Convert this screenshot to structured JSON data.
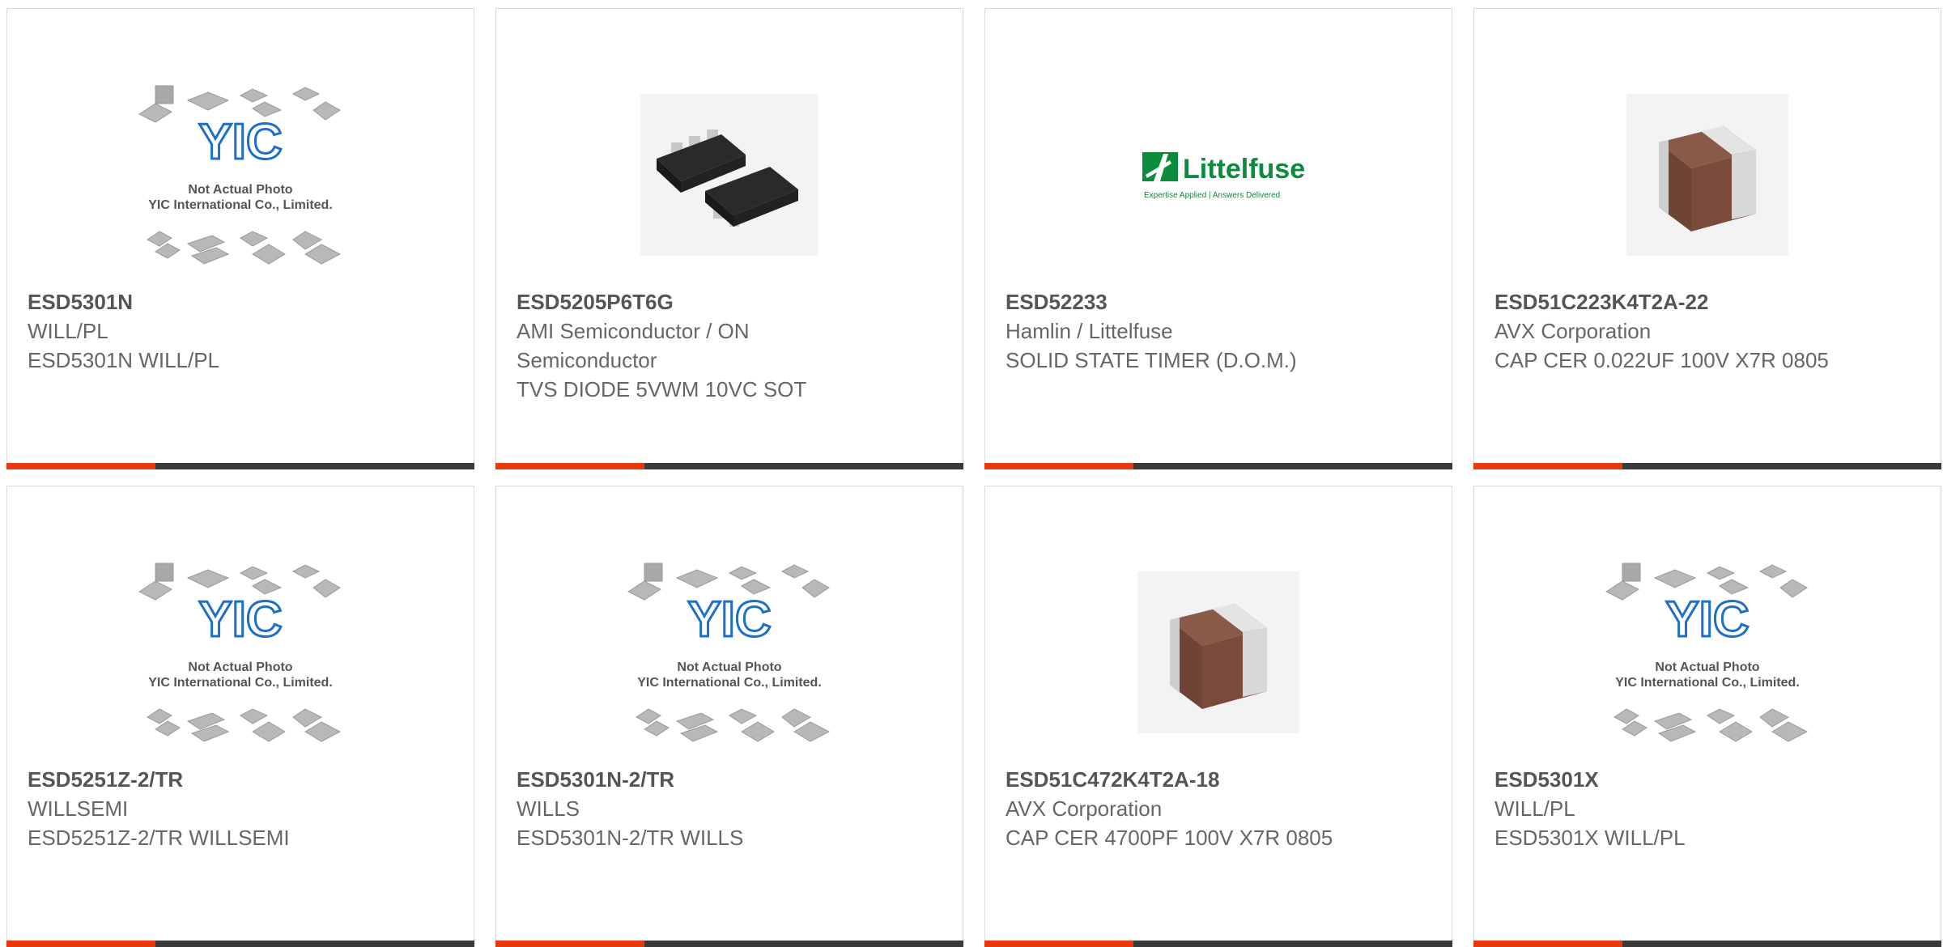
{
  "colors": {
    "accent": "#e8380d",
    "bar": "#3a3a3a",
    "yic_blue": "#1f6fc4",
    "littelfuse_green": "#0a8c3c",
    "capacitor_body": "#7a4a3a"
  },
  "placeholder": {
    "line1": "Not Actual Photo",
    "line2": "YIC International Co., Limited.",
    "logo_text": "YIC"
  },
  "littelfuse_logo": {
    "name": "Littelfuse",
    "tagline": "Expertise Applied | Answers Delivered"
  },
  "products": [
    {
      "part_number": "ESD5301N",
      "manufacturer": "WILL/PL",
      "description": "ESD5301N WILL/PL",
      "image": "yic-placeholder"
    },
    {
      "part_number": "ESD5205P6T6G",
      "manufacturer": "AMI Semiconductor / ON Semiconductor",
      "description": "TVS DIODE 5VWM 10VC SOT",
      "image": "sot-package-photo"
    },
    {
      "part_number": "ESD52233",
      "manufacturer": "Hamlin / Littelfuse",
      "description": "SOLID STATE TIMER (D.O.M.)",
      "image": "littelfuse-logo"
    },
    {
      "part_number": "ESD51C223K4T2A-22",
      "manufacturer": "AVX Corporation",
      "description": "CAP CER 0.022UF 100V X7R 0805",
      "image": "capacitor-photo"
    },
    {
      "part_number": "ESD5251Z-2/TR",
      "manufacturer": "WILLSEMI",
      "description": "ESD5251Z-2/TR WILLSEMI",
      "image": "yic-placeholder"
    },
    {
      "part_number": "ESD5301N-2/TR",
      "manufacturer": "WILLS",
      "description": "ESD5301N-2/TR WILLS",
      "image": "yic-placeholder"
    },
    {
      "part_number": "ESD51C472K4T2A-18",
      "manufacturer": "AVX Corporation",
      "description": "CAP CER 4700PF 100V X7R 0805",
      "image": "capacitor-photo"
    },
    {
      "part_number": "ESD5301X",
      "manufacturer": "WILL/PL",
      "description": "ESD5301X WILL/PL",
      "image": "yic-placeholder"
    }
  ]
}
